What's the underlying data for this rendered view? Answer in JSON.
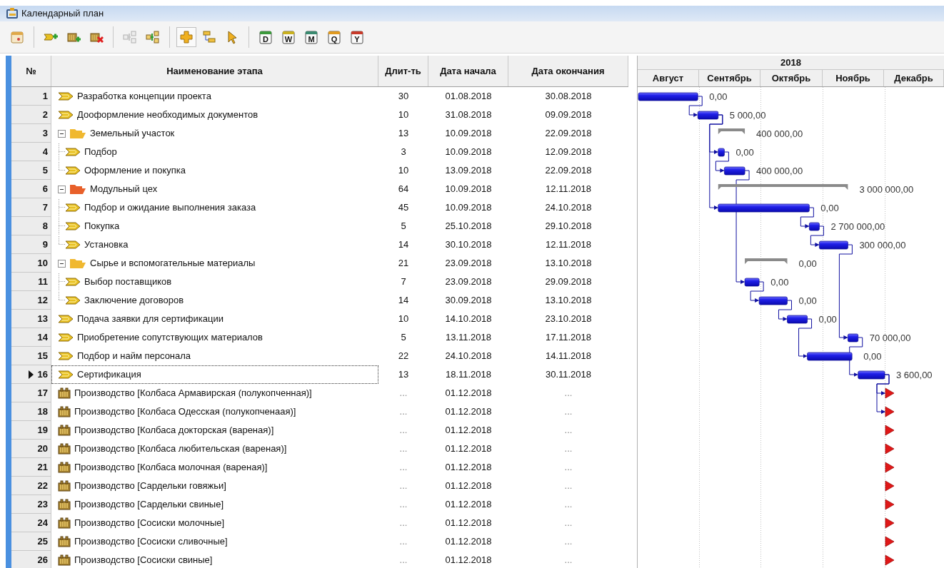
{
  "window": {
    "title": "Календарный план"
  },
  "toolbar": [
    [
      {
        "kind": "calendar"
      }
    ],
    [
      {
        "kind": "add-task"
      },
      {
        "kind": "add-production"
      },
      {
        "kind": "delete"
      }
    ],
    [
      {
        "kind": "link",
        "disabled": true
      },
      {
        "kind": "link",
        "disabled": false
      }
    ],
    [
      {
        "kind": "add",
        "pressed": true
      },
      {
        "kind": "hierarchy",
        "pressed": false
      },
      {
        "kind": "pointer",
        "pressed": false
      }
    ],
    [
      {
        "kind": "scale",
        "label": "D",
        "color": "#3c9a3c"
      },
      {
        "kind": "scale",
        "label": "W",
        "color": "#c8b020"
      },
      {
        "kind": "scale",
        "label": "M",
        "color": "#3a8a70"
      },
      {
        "kind": "scale",
        "label": "Q",
        "color": "#e09a20"
      },
      {
        "kind": "scale",
        "label": "Y",
        "color": "#c83a2a"
      }
    ]
  ],
  "table": {
    "columns": [
      "№",
      "Наименование этапа",
      "Длит-ть",
      "Дата начала",
      "Дата окончания"
    ]
  },
  "gantt": {
    "year": "2018",
    "months": [
      "Август",
      "Сентябрь",
      "Октябрь",
      "Ноябрь",
      "Декабрь"
    ]
  },
  "rows": [
    {
      "number": "1",
      "kind": "task",
      "name": "Разработка концепции проекта",
      "duration": "30",
      "start": "01.08.2018",
      "end": "30.08.2018",
      "cost": "0,00",
      "linked": false,
      "selected": false
    },
    {
      "number": "2",
      "kind": "task",
      "name": "Дооформление необходимых документов",
      "duration": "10",
      "start": "31.08.2018",
      "end": "09.09.2018",
      "cost": "5 000,00",
      "linked": true,
      "selected": false
    },
    {
      "number": "3",
      "kind": "group",
      "name": "Земельный участок",
      "duration": "13",
      "start": "10.09.2018",
      "end": "22.09.2018",
      "cost": "400 000,00",
      "expanded": true,
      "color": "#f0b830",
      "linked": false,
      "selected": false,
      "children": [
        {
          "number": "4",
          "kind": "task",
          "name": "Подбор",
          "duration": "3",
          "start": "10.09.2018",
          "end": "12.09.2018",
          "cost": "0,00",
          "linked": true,
          "selected": false
        },
        {
          "number": "5",
          "kind": "task",
          "name": "Оформление и покупка",
          "duration": "10",
          "start": "13.09.2018",
          "end": "22.09.2018",
          "cost": "400 000,00",
          "linked": true,
          "selected": false
        }
      ]
    },
    {
      "number": "6",
      "kind": "group",
      "name": "Модульный цех",
      "duration": "64",
      "start": "10.09.2018",
      "end": "12.11.2018",
      "cost": "3 000 000,00",
      "expanded": true,
      "color": "#e8602a",
      "linked": false,
      "selected": false,
      "children": [
        {
          "number": "7",
          "kind": "task",
          "name": "Подбор и ожидание выполнения заказа",
          "duration": "45",
          "start": "10.09.2018",
          "end": "24.10.2018",
          "cost": "0,00",
          "linked": true,
          "selected": false
        },
        {
          "number": "8",
          "kind": "task",
          "name": "Покупка",
          "duration": "5",
          "start": "25.10.2018",
          "end": "29.10.2018",
          "cost": "2 700 000,00",
          "linked": true,
          "selected": false
        },
        {
          "number": "9",
          "kind": "task",
          "name": "Установка",
          "duration": "14",
          "start": "30.10.2018",
          "end": "12.11.2018",
          "cost": "300 000,00",
          "linked": true,
          "selected": false
        }
      ]
    },
    {
      "number": "10",
      "kind": "group",
      "name": "Сырье и вспомогательные материалы",
      "duration": "21",
      "start": "23.09.2018",
      "end": "13.10.2018",
      "cost": "0,00",
      "expanded": true,
      "color": "#f0b830",
      "linked": false,
      "selected": false,
      "children": [
        {
          "number": "11",
          "kind": "task",
          "name": "Выбор поставщиков",
          "duration": "7",
          "start": "23.09.2018",
          "end": "29.09.2018",
          "cost": "0,00",
          "linked": true,
          "selected": false
        },
        {
          "number": "12",
          "kind": "task",
          "name": "Заключение договоров",
          "duration": "14",
          "start": "30.09.2018",
          "end": "13.10.2018",
          "cost": "0,00",
          "linked": true,
          "selected": false
        }
      ]
    },
    {
      "number": "13",
      "kind": "task",
      "name": "Подача заявки для сертификации",
      "duration": "10",
      "start": "14.10.2018",
      "end": "23.10.2018",
      "cost": "0,00",
      "linked": true,
      "selected": false
    },
    {
      "number": "14",
      "kind": "task",
      "name": "Приобретение сопутствующих материалов",
      "duration": "5",
      "start": "13.11.2018",
      "end": "17.11.2018",
      "cost": "70 000,00",
      "linked": true,
      "selected": false
    },
    {
      "number": "15",
      "kind": "task",
      "name": "Подбор и найм персонала",
      "duration": "22",
      "start": "24.10.2018",
      "end": "14.11.2018",
      "cost": "0,00",
      "linked": true,
      "selected": false
    },
    {
      "number": "16",
      "kind": "task",
      "name": "Сертификация",
      "duration": "13",
      "start": "18.11.2018",
      "end": "30.11.2018",
      "cost": "3 600,00",
      "linked": true,
      "selected": true
    },
    {
      "number": "17",
      "kind": "production",
      "name": "Производство [Колбаса Армавирская (полукопченная)]",
      "duration": "...",
      "start": "01.12.2018",
      "end": "...",
      "linked": true,
      "selected": false
    },
    {
      "number": "18",
      "kind": "production",
      "name": "Производство [Колбаса Одесская (полукопченаая)]",
      "duration": "...",
      "start": "01.12.2018",
      "end": "...",
      "linked": true,
      "selected": false
    },
    {
      "number": "19",
      "kind": "production",
      "name": "Производство [Колбаса докторская (вареная)]",
      "duration": "...",
      "start": "01.12.2018",
      "end": "...",
      "linked": false,
      "selected": false
    },
    {
      "number": "20",
      "kind": "production",
      "name": "Производство [Колбаса любительская (вареная)]",
      "duration": "...",
      "start": "01.12.2018",
      "end": "...",
      "linked": false,
      "selected": false
    },
    {
      "number": "21",
      "kind": "production",
      "name": "Производство [Колбаса молочная (вареная)]",
      "duration": "...",
      "start": "01.12.2018",
      "end": "...",
      "linked": false,
      "selected": false
    },
    {
      "number": "22",
      "kind": "production",
      "name": "Производство [Сардельки говяжьи]",
      "duration": "...",
      "start": "01.12.2018",
      "end": "...",
      "linked": false,
      "selected": false
    },
    {
      "number": "23",
      "kind": "production",
      "name": "Производство [Сардельки свиные]",
      "duration": "...",
      "start": "01.12.2018",
      "end": "...",
      "linked": false,
      "selected": false
    },
    {
      "number": "24",
      "kind": "production",
      "name": "Производство [Сосиски молочные]",
      "duration": "...",
      "start": "01.12.2018",
      "end": "...",
      "linked": false,
      "selected": false
    },
    {
      "number": "25",
      "kind": "production",
      "name": "Производство [Сосиски сливочные]",
      "duration": "...",
      "start": "01.12.2018",
      "end": "...",
      "linked": false,
      "selected": false
    },
    {
      "number": "26",
      "kind": "production",
      "name": "Производство [Сосиски свиные]",
      "duration": "...",
      "start": "01.12.2018",
      "end": "...",
      "linked": false,
      "selected": false
    }
  ]
}
